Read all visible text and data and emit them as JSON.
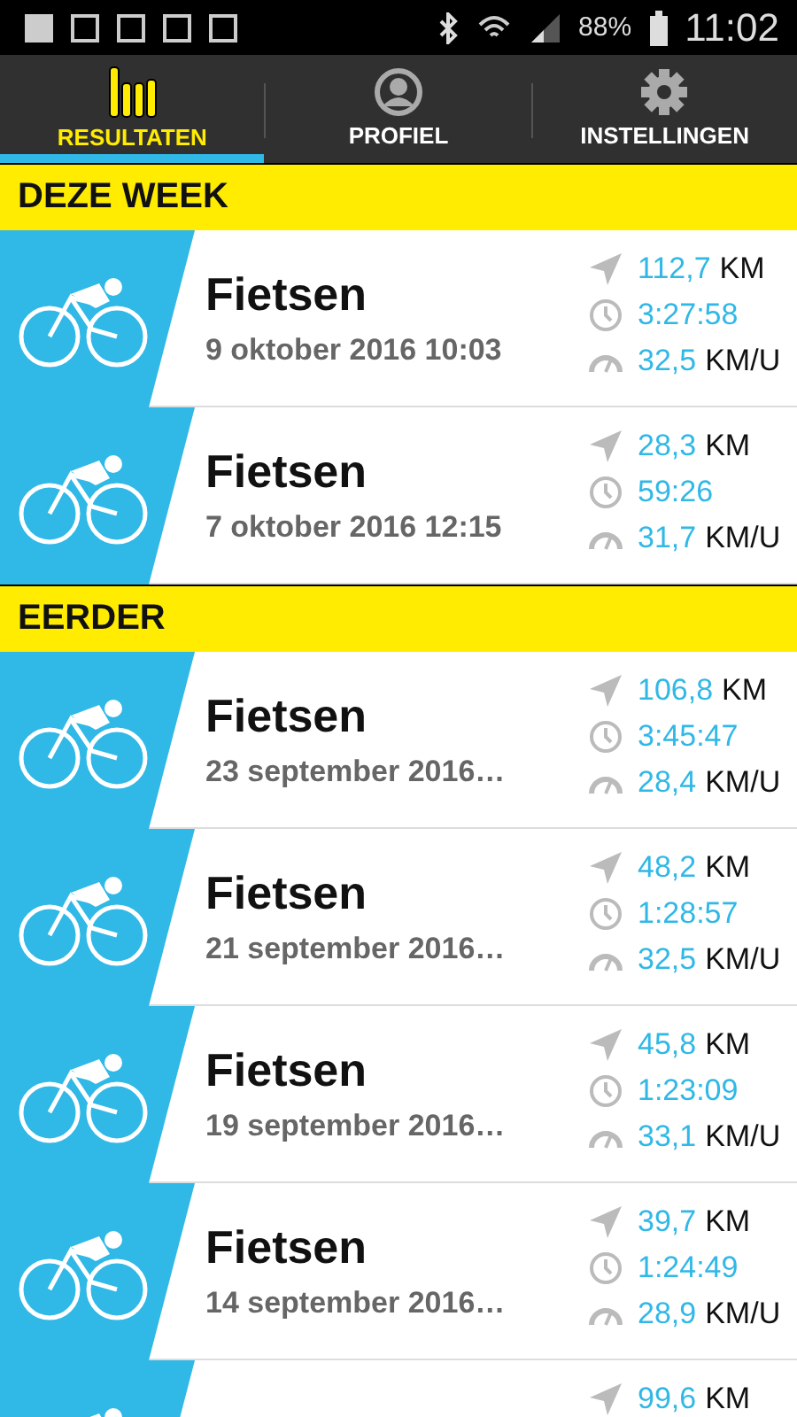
{
  "status_bar": {
    "battery": "88%",
    "time": "11:02"
  },
  "tabs": [
    {
      "label": "RESULTATEN",
      "selected": true,
      "kind": "results"
    },
    {
      "label": "PROFIEL",
      "selected": false,
      "kind": "profile"
    },
    {
      "label": "INSTELLINGEN",
      "selected": false,
      "kind": "settings"
    }
  ],
  "sections": [
    {
      "title": "DEZE WEEK",
      "rides": [
        {
          "title": "Fietsen",
          "date": "9 oktober 2016 10:03",
          "distance": "112,7",
          "distance_unit": "KM",
          "duration": "3:27:58",
          "speed": "32,5",
          "speed_unit": "KM/U"
        },
        {
          "title": "Fietsen",
          "date": "7 oktober 2016 12:15",
          "distance": "28,3",
          "distance_unit": "KM",
          "duration": "59:26",
          "speed": "31,7",
          "speed_unit": "KM/U"
        }
      ]
    },
    {
      "title": "EERDER",
      "rides": [
        {
          "title": "Fietsen",
          "date": "23 september 2016…",
          "distance": "106,8",
          "distance_unit": "KM",
          "duration": "3:45:47",
          "speed": "28,4",
          "speed_unit": "KM/U"
        },
        {
          "title": "Fietsen",
          "date": "21 september 2016…",
          "distance": "48,2",
          "distance_unit": "KM",
          "duration": "1:28:57",
          "speed": "32,5",
          "speed_unit": "KM/U"
        },
        {
          "title": "Fietsen",
          "date": "19 september 2016…",
          "distance": "45,8",
          "distance_unit": "KM",
          "duration": "1:23:09",
          "speed": "33,1",
          "speed_unit": "KM/U"
        },
        {
          "title": "Fietsen",
          "date": "14 september 2016…",
          "distance": "39,7",
          "distance_unit": "KM",
          "duration": "1:24:49",
          "speed": "28,9",
          "speed_unit": "KM/U"
        },
        {
          "distance": "99,6",
          "distance_unit": "KM"
        }
      ]
    }
  ]
}
